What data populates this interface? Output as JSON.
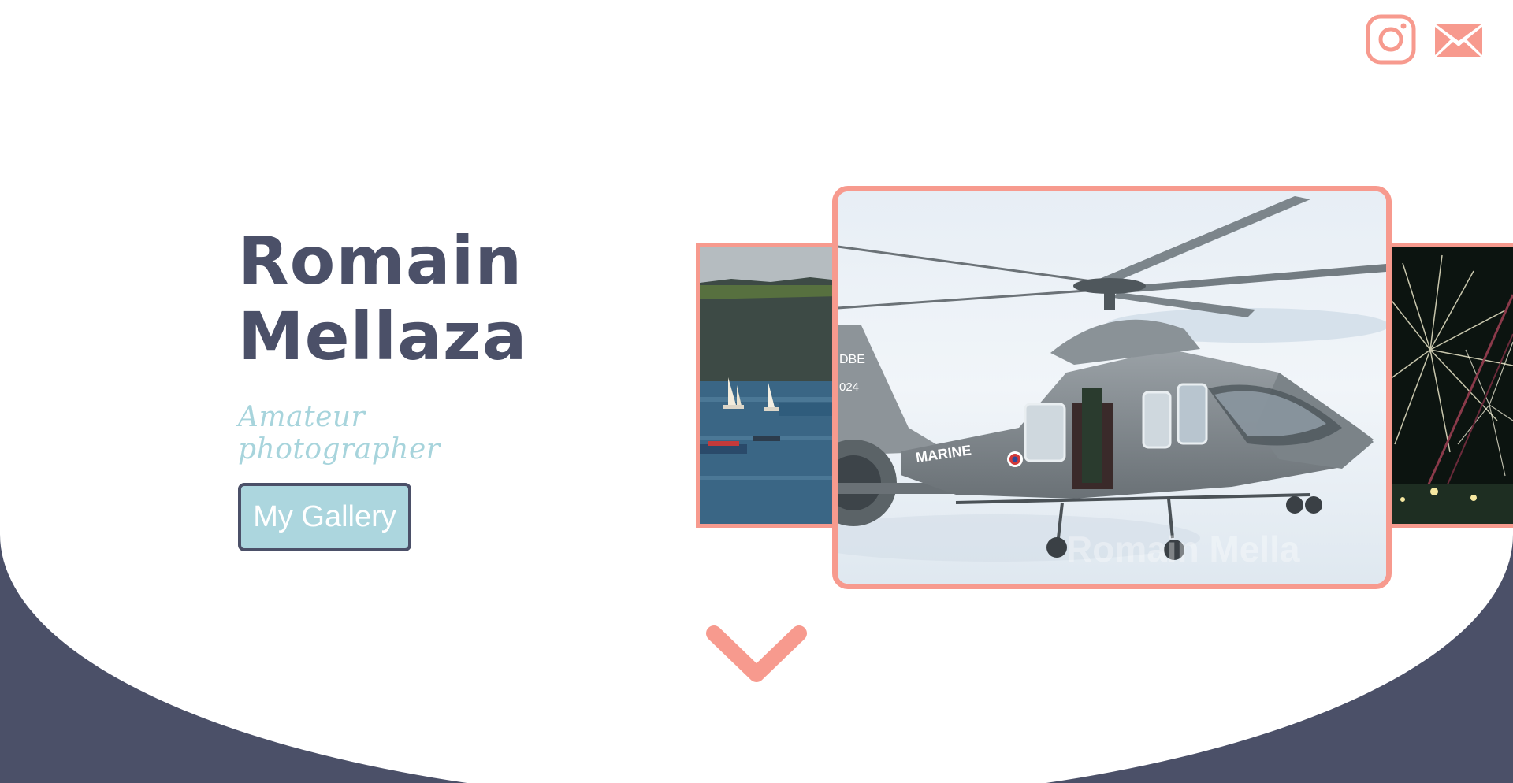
{
  "header": {
    "social": [
      {
        "icon": "instagram-icon",
        "label": "Instagram"
      },
      {
        "icon": "mail-icon",
        "label": "Email"
      }
    ]
  },
  "intro": {
    "name_first": "Romain",
    "name_last": "Mellaza",
    "tagline": "Amateur photographer",
    "cta_label": "My Gallery"
  },
  "carousel": {
    "slides": [
      {
        "subject": "sailboats-bay",
        "position": "previous"
      },
      {
        "subject": "helicopter",
        "position": "current"
      },
      {
        "subject": "fireworks",
        "position": "next"
      }
    ],
    "current_slide_text": {
      "tail_code_top": "DBE",
      "tail_code_bottom": "024",
      "body_marking": "MARINE",
      "watermark": "Romain Mella"
    }
  },
  "colors": {
    "accent": "#f79a8e",
    "primary_dark": "#4b5068",
    "secondary": "#acd6de",
    "background": "#ffffff"
  },
  "scroll": {
    "icon": "chevron-down-icon"
  }
}
